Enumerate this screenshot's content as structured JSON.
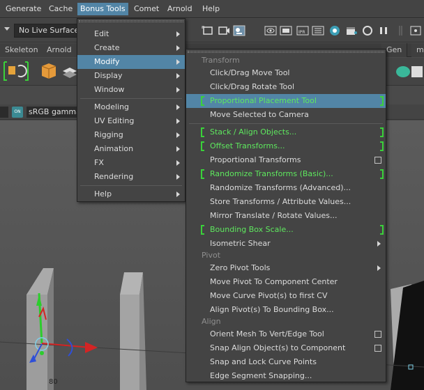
{
  "menubar": {
    "items": [
      "Generate",
      "Cache",
      "Bonus Tools",
      "Comet",
      "Arnold",
      "Help"
    ]
  },
  "statusline": {
    "live_surface": "No Live Surface"
  },
  "shelf_tabs": [
    "Skeleton",
    "Arnold",
    "Gen",
    "m"
  ],
  "viewport": {
    "colorspace": "sRGB gamma",
    "toggle_text": "ON",
    "readout": "80"
  },
  "bonus_menu": {
    "items": [
      "Edit",
      "Create",
      "Modify",
      "Display",
      "Window",
      "Modeling",
      "UV Editing",
      "Rigging",
      "Animation",
      "FX",
      "Rendering",
      "Help"
    ]
  },
  "modify_menu": {
    "sections": [
      "Transform",
      "Pivot",
      "Align"
    ],
    "transform_items": [
      "Click/Drag Move Tool",
      "Click/Drag Rotate Tool",
      "Proportional Placement Tool",
      "Move Selected to Camera",
      "Stack / Align Objects...",
      "Offset Transforms...",
      "Proportional Transforms",
      "Randomize Transforms (Basic)...",
      "Randomize Transforms (Advanced)...",
      "Store Transforms / Attribute Values...",
      "Mirror Translate / Rotate Values...",
      "Bounding Box Scale...",
      "Isometric Shear"
    ],
    "pivot_items": [
      "Zero Pivot Tools",
      "Move Pivot To Component Center",
      "Move Curve Pivot(s) to first CV",
      "Align Pivot(s) To Bounding Box..."
    ],
    "align_items": [
      "Orient Mesh To Vert/Edge Tool",
      "Snap Align Object(s) to Component",
      "Snap and Lock Curve Points",
      "Edge Segment Snapping..."
    ]
  },
  "colors": {
    "highlight": "#5285a6",
    "green_text": "#5ee85e",
    "menu_bg": "#444444"
  }
}
